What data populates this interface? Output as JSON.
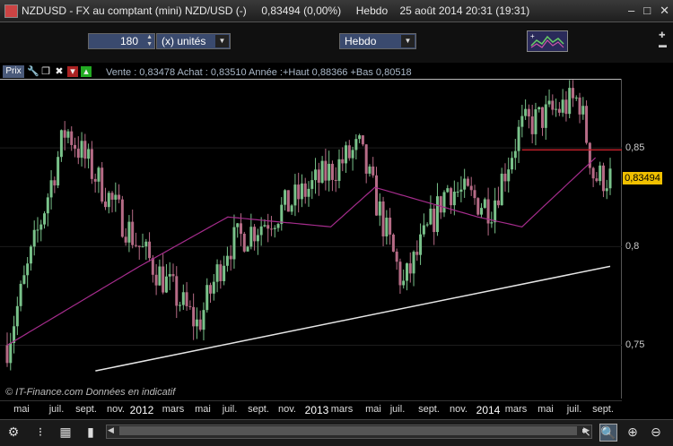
{
  "window": {
    "title": "NZDUSD - FX au comptant (mini) NZD/USD (-)     0,83494 (0,00%)     Hebdo    25 août 2014 20:31 (19:31)",
    "minimize": "–",
    "maximize": "□",
    "close": "✕"
  },
  "toolbar": {
    "quantity": "180",
    "units_label": "(x) unités",
    "period_label": "Hebdo",
    "indicator_icon": "candles-indicator-icon"
  },
  "chart_header": {
    "prix_label": "Prix",
    "info": "Vente : 0,83478 Achat : 0,83510 Année :+Haut 0,88366 +Bas 0,80518"
  },
  "colors": {
    "up": "#79c28a",
    "down": "#b66b86",
    "ma": "#a52c8c",
    "resistance": "#c0202a",
    "trendline": "#e6e6e6",
    "last_price_bg": "#f0c000"
  },
  "credit": {
    "source": "© IT-Finance.com",
    "note": "Données en indicatif"
  },
  "last_price": "0,83494",
  "price_axis": {
    "labels": [
      "0,85",
      "0,8",
      "0,75"
    ]
  },
  "time_axis": {
    "labels": [
      "mai",
      "juil.",
      "sept.",
      "nov.",
      "2012",
      "mars",
      "mai",
      "juil.",
      "sept.",
      "nov.",
      "2013",
      "mars",
      "mai",
      "juil.",
      "sept.",
      "nov.",
      "2014",
      "mars",
      "mai",
      "juil.",
      "sept."
    ],
    "years": [
      "2012",
      "2013",
      "2014"
    ]
  },
  "chart_data": {
    "type": "candlestick",
    "x_range": [
      "2011-04",
      "2014-09"
    ],
    "y_range": [
      0.723,
      0.885
    ],
    "key_points": [
      {
        "date": "2011-04",
        "close": 0.75
      },
      {
        "date": "2011-08",
        "close": 0.86
      },
      {
        "date": "2012-01",
        "close": 0.8
      },
      {
        "date": "2012-05",
        "close": 0.76
      },
      {
        "date": "2012-07",
        "close": 0.8
      },
      {
        "date": "2012-11",
        "close": 0.82
      },
      {
        "date": "2013-04",
        "close": 0.85
      },
      {
        "date": "2013-07",
        "close": 0.78
      },
      {
        "date": "2013-10",
        "close": 0.83
      },
      {
        "date": "2014-01",
        "close": 0.82
      },
      {
        "date": "2014-03",
        "close": 0.86
      },
      {
        "date": "2014-07",
        "close": 0.875
      },
      {
        "date": "2014-08",
        "close": 0.83494
      }
    ],
    "moving_average": [
      {
        "date": "2011-04",
        "value": 0.75
      },
      {
        "date": "2012-01",
        "value": 0.79
      },
      {
        "date": "2012-07",
        "value": 0.815
      },
      {
        "date": "2013-02",
        "value": 0.81
      },
      {
        "date": "2013-05",
        "value": 0.83
      },
      {
        "date": "2013-12",
        "value": 0.815
      },
      {
        "date": "2014-03",
        "value": 0.81
      },
      {
        "date": "2014-08",
        "value": 0.845
      }
    ],
    "resistance_level": 0.849,
    "trendline": [
      {
        "date": "2011-10",
        "value": 0.737
      },
      {
        "date": "2014-09",
        "value": 0.79
      }
    ]
  }
}
